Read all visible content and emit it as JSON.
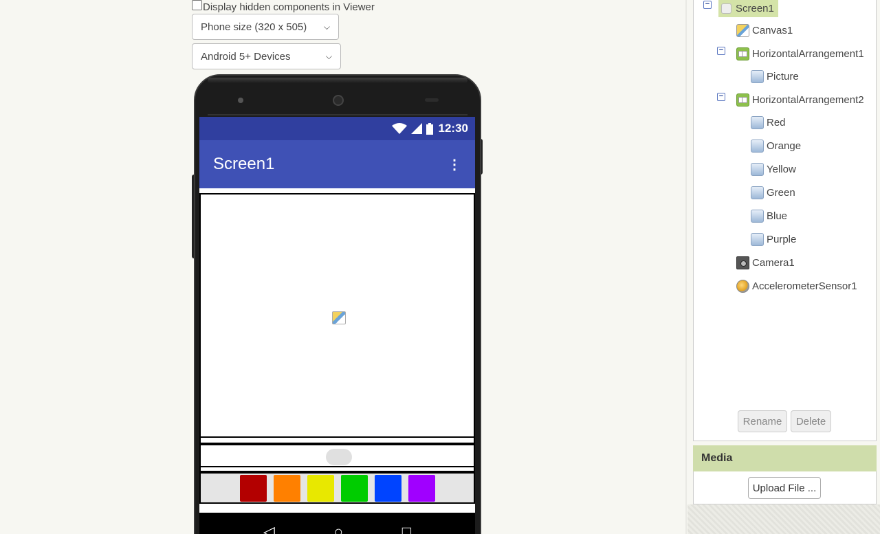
{
  "viewer": {
    "hidden_components_label": "Display hidden components in Viewer",
    "phone_size": "Phone size (320 x 505)",
    "device_theme": "Android 5+ Devices"
  },
  "phone": {
    "status_time": "12:30",
    "app_title": "Screen1",
    "menu_glyph": "⋮",
    "color_buttons": [
      {
        "name": "Red",
        "color": "#b30000"
      },
      {
        "name": "Orange",
        "color": "#ff8000"
      },
      {
        "name": "Yellow",
        "color": "#e8e800"
      },
      {
        "name": "Green",
        "color": "#00cc00"
      },
      {
        "name": "Blue",
        "color": "#0044ff"
      },
      {
        "name": "Purple",
        "color": "#a000ff"
      }
    ],
    "nav": {
      "back": "◁",
      "home": "○",
      "recent": "□"
    }
  },
  "tree": {
    "screen": "Screen1",
    "canvas": "Canvas1",
    "ha1": "HorizontalArrangement1",
    "picture": "Picture",
    "ha2": "HorizontalArrangement2",
    "red": "Red",
    "orange": "Orange",
    "yellow": "Yellow",
    "green": "Green",
    "blue": "Blue",
    "purple": "Purple",
    "camera": "Camera1",
    "accelerometer": "AccelerometerSensor1",
    "collapse_glyph": "−"
  },
  "actions": {
    "rename": "Rename",
    "delete": "Delete"
  },
  "media": {
    "title": "Media",
    "upload": "Upload File ..."
  }
}
